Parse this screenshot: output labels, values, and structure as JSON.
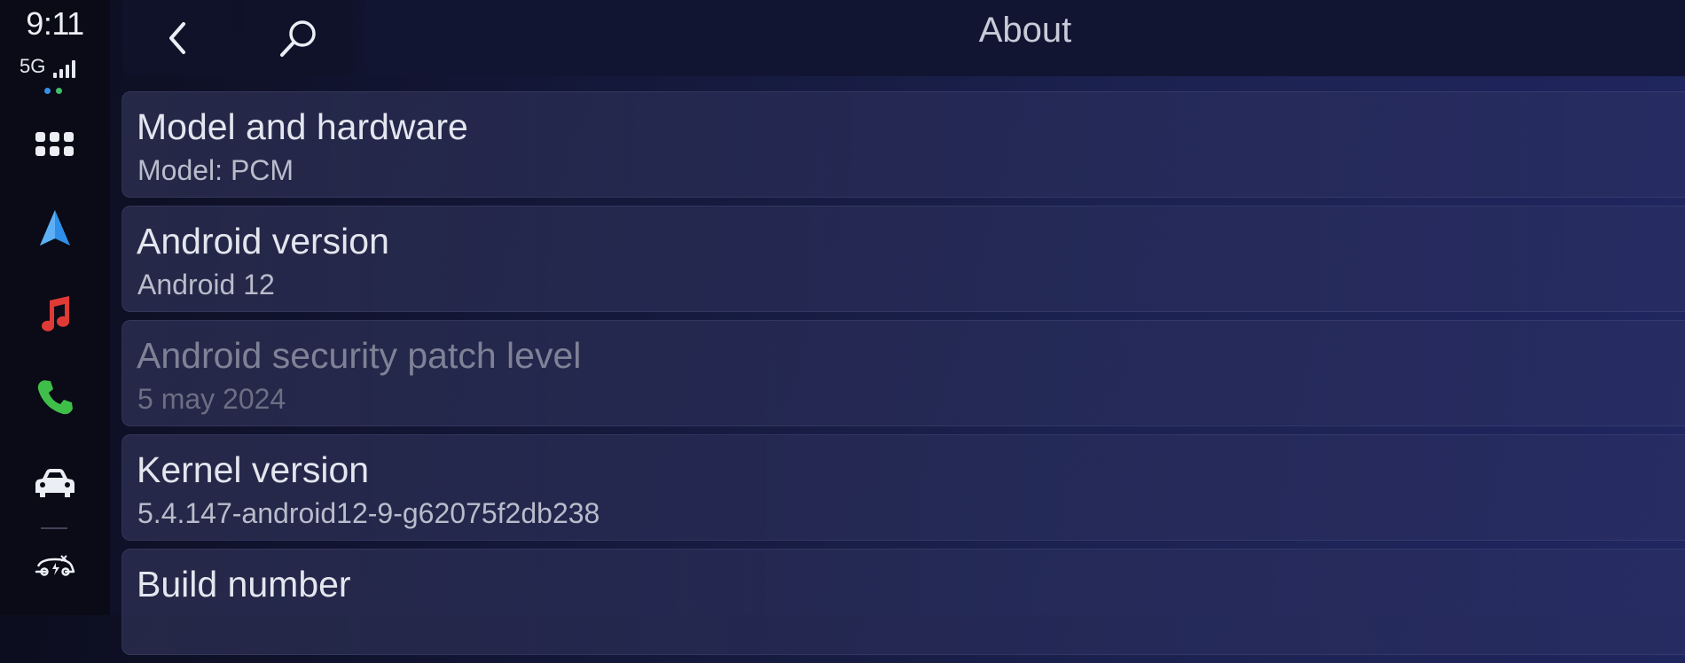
{
  "status": {
    "time": "9:11",
    "network": "5G",
    "signal_bars": 4
  },
  "colors": {
    "nav_arrow": "#2f8fe8",
    "music_note": "#e03a36",
    "phone": "#3fbf4a",
    "dot_blue": "#3a8ee6",
    "dot_green": "#3fbf6a"
  },
  "rail": {
    "items": [
      {
        "icon": "app-grid-icon"
      },
      {
        "icon": "navigation-arrow-icon"
      },
      {
        "icon": "music-note-icon"
      },
      {
        "icon": "phone-icon"
      },
      {
        "icon": "car-icon"
      },
      {
        "icon": "ev-charging-car-icon"
      }
    ]
  },
  "header": {
    "back_icon": "chevron-left-icon",
    "search_icon": "search-icon",
    "title": "About"
  },
  "list": {
    "items": [
      {
        "title": "Model and hardware",
        "subtitle": "Model: PCM",
        "enabled": true
      },
      {
        "title": "Android version",
        "subtitle": "Android 12",
        "enabled": true
      },
      {
        "title": "Android security patch level",
        "subtitle": "5 may 2024",
        "enabled": false
      },
      {
        "title": "Kernel version",
        "subtitle": "5.4.147-android12-9-g62075f2db238",
        "enabled": true
      },
      {
        "title": "Build number",
        "subtitle": "",
        "enabled": true
      }
    ]
  }
}
